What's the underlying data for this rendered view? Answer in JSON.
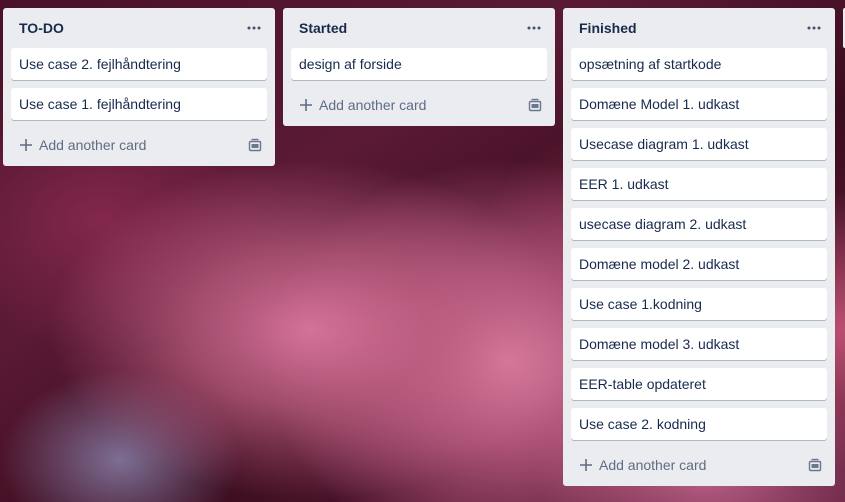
{
  "lists": [
    {
      "title": "TO-DO",
      "cards": [
        "Use case 2. fejlhåndtering",
        "Use case 1. fejlhåndtering"
      ],
      "add_label": "Add another card"
    },
    {
      "title": "Started",
      "cards": [
        "design af forside"
      ],
      "add_label": "Add another card"
    },
    {
      "title": "Finished",
      "cards": [
        "opsætning af startkode",
        "Domæne Model 1. udkast",
        "Usecase diagram 1. udkast",
        "EER 1. udkast",
        "usecase diagram 2. udkast",
        "Domæne model 2. udkast",
        "Use case 1.kodning",
        "Domæne model 3. udkast",
        "EER-table opdateret",
        "Use case 2. kodning"
      ],
      "add_label": "Add another card"
    }
  ],
  "icons": {
    "list_menu": "ellipsis-icon",
    "add": "plus-icon",
    "template": "card-template-icon"
  },
  "colors": {
    "list_bg": "#ebecf0",
    "card_bg": "#ffffff",
    "text": "#172b4d",
    "muted": "#5e6c84"
  }
}
